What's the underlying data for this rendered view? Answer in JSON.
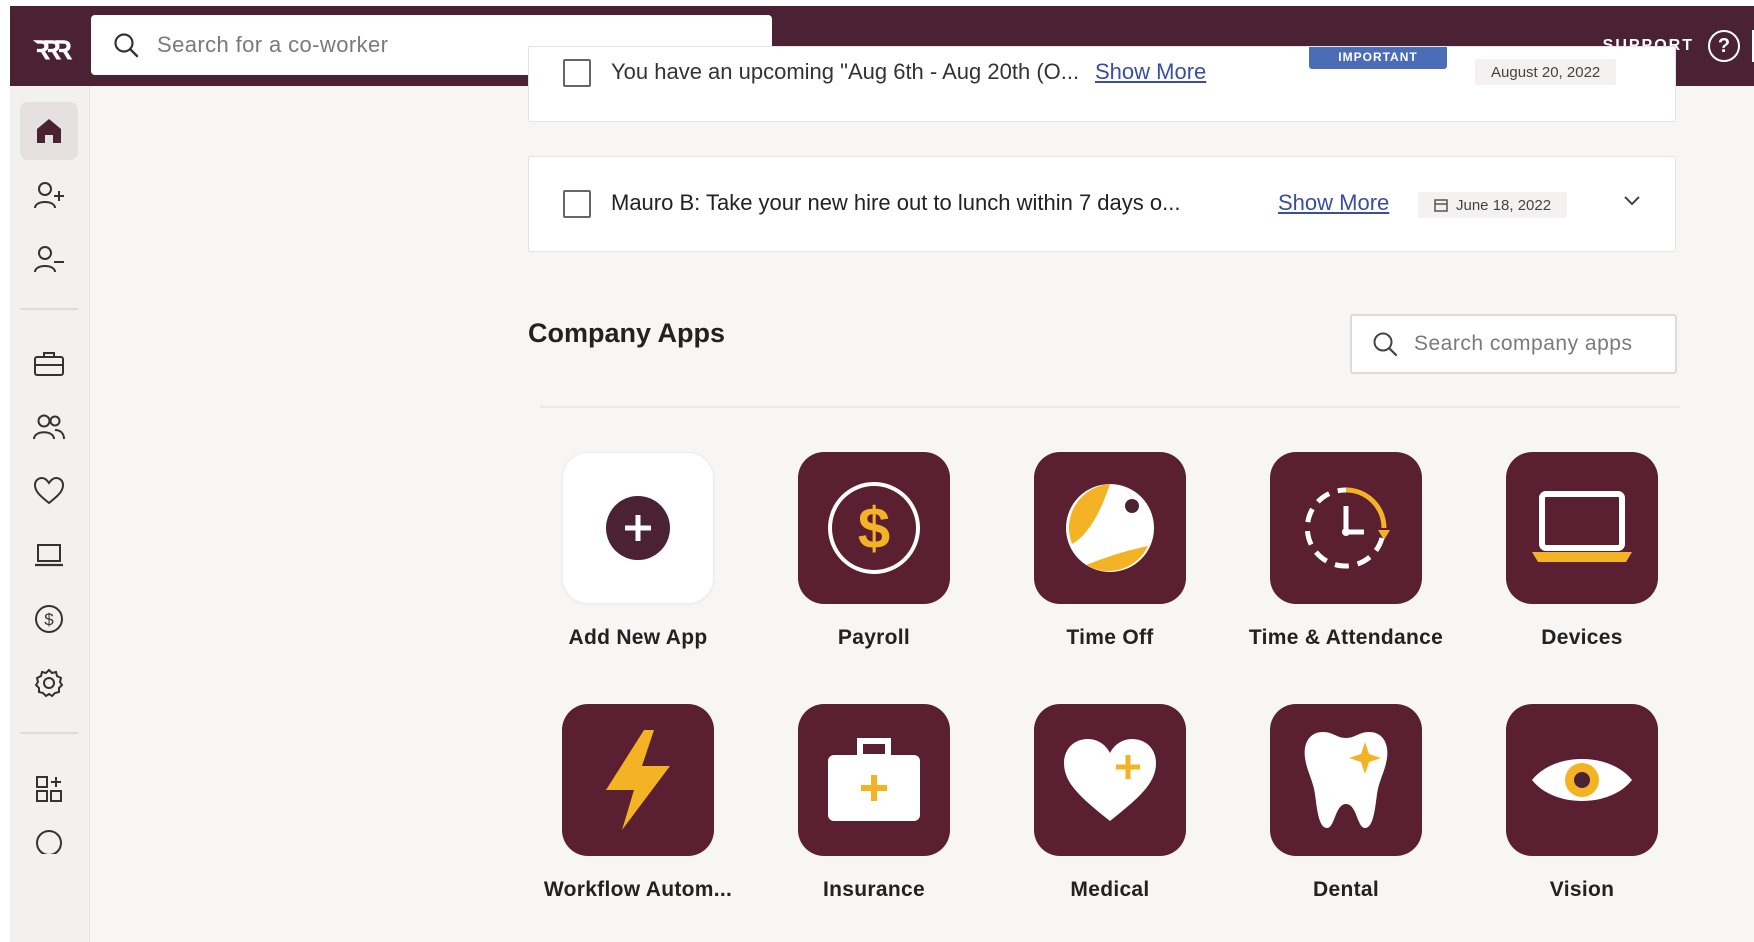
{
  "topbar": {
    "logo_text": "ꝛꝛꝛ",
    "search_placeholder": "Search for a co-worker",
    "support_label": "SUPPORT",
    "help_glyph": "?"
  },
  "sidebar": {
    "items": [
      {
        "icon": "home-icon",
        "active": true
      },
      {
        "icon": "add-person-icon"
      },
      {
        "icon": "remove-person-icon"
      },
      {
        "icon": "briefcase-icon"
      },
      {
        "icon": "people-icon"
      },
      {
        "icon": "heart-icon"
      },
      {
        "icon": "laptop-icon"
      },
      {
        "icon": "dollar-icon"
      },
      {
        "icon": "gear-icon"
      },
      {
        "icon": "apps-add-icon"
      }
    ]
  },
  "tasks": [
    {
      "text": "You have an upcoming \"Aug 6th - Aug 20th (O...",
      "link": "Show More",
      "badge": "IMPORTANT",
      "date": "August 20, 2022"
    },
    {
      "text": "Mauro B: Take your new hire out to lunch within 7 days o...",
      "link": "Show More",
      "date": "June 18, 2022"
    }
  ],
  "company_apps": {
    "title": "Company Apps",
    "search_placeholder": "Search company apps",
    "apps": [
      {
        "label": "Add New App",
        "icon": "add-app-icon"
      },
      {
        "label": "Payroll",
        "icon": "dollar-coin-icon"
      },
      {
        "label": "Time Off",
        "icon": "beach-ball-icon"
      },
      {
        "label": "Time & Attendance",
        "icon": "clock-icon"
      },
      {
        "label": "Devices",
        "icon": "laptop-icon"
      },
      {
        "label": "Workflow Autom...",
        "icon": "lightning-icon"
      },
      {
        "label": "Insurance",
        "icon": "medical-kit-icon"
      },
      {
        "label": "Medical",
        "icon": "heart-plus-icon"
      },
      {
        "label": "Dental",
        "icon": "tooth-icon"
      },
      {
        "label": "Vision",
        "icon": "eye-icon"
      }
    ]
  },
  "colors": {
    "brand": "#4b2234",
    "tile": "#5a1f30",
    "accent": "#f4b324",
    "link": "#3a4ea0"
  }
}
